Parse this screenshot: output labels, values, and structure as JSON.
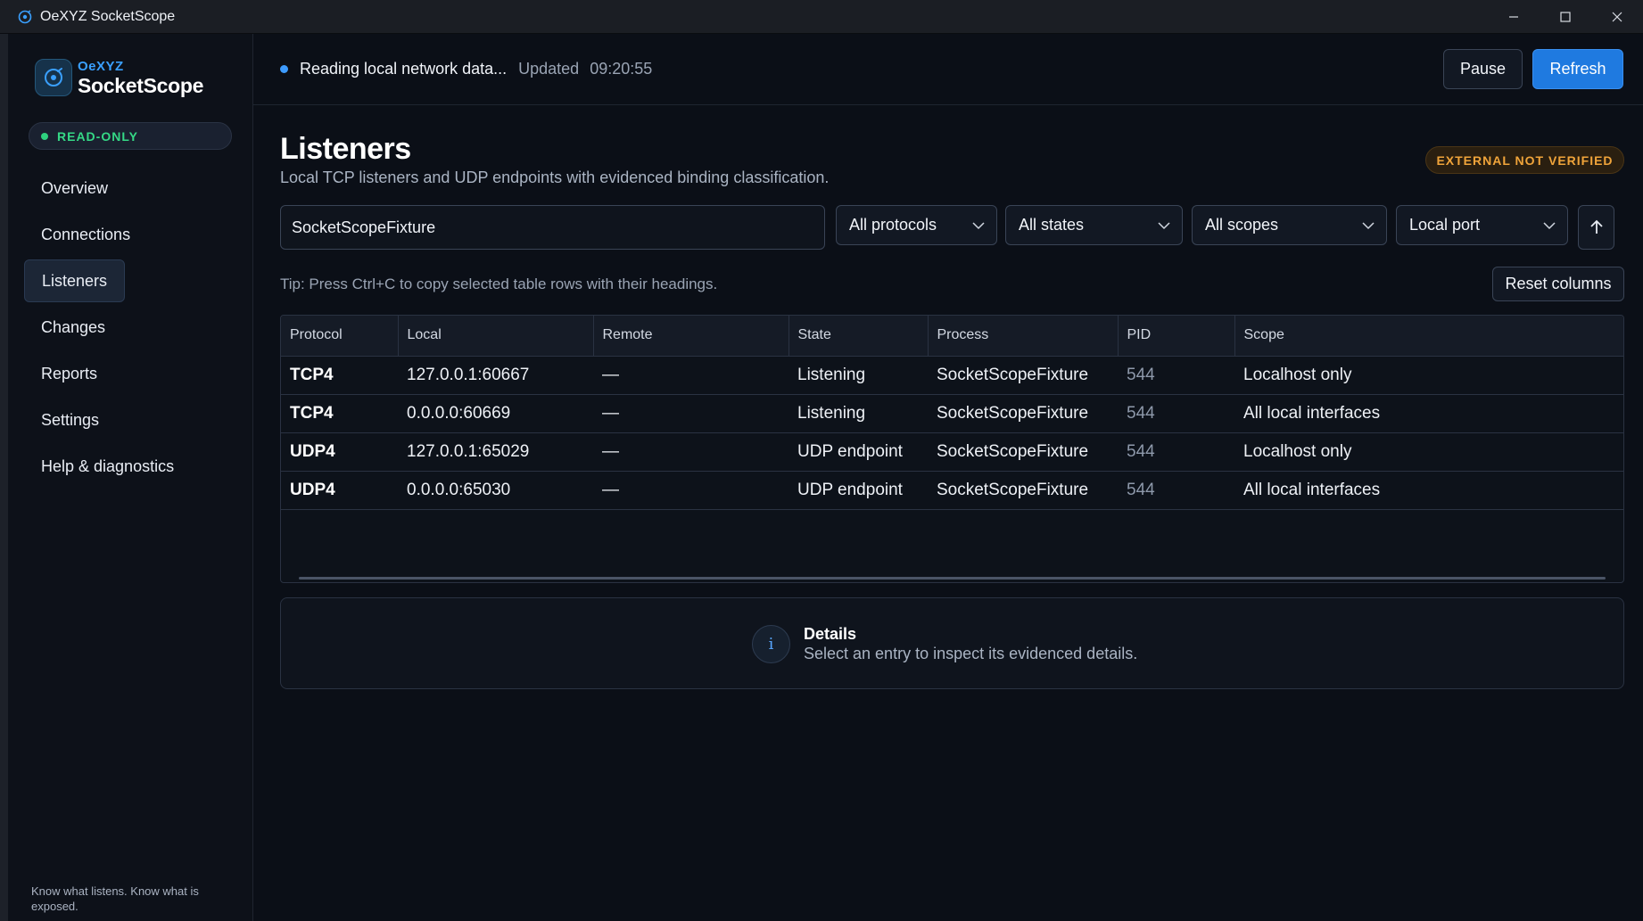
{
  "window": {
    "title": "OeXYZ SocketScope"
  },
  "brand": {
    "sub": "OeXYZ",
    "main": "SocketScope"
  },
  "mode_badge": "READ-ONLY",
  "nav": [
    {
      "label": "Overview",
      "active": false
    },
    {
      "label": "Connections",
      "active": false
    },
    {
      "label": "Listeners",
      "active": true
    },
    {
      "label": "Changes",
      "active": false
    },
    {
      "label": "Reports",
      "active": false
    },
    {
      "label": "Settings",
      "active": false
    },
    {
      "label": "Help & diagnostics",
      "active": false
    }
  ],
  "sidebar_footer": "Know what listens. Know what is exposed.",
  "status": {
    "text": "Reading local network data...",
    "updated_label": "Updated",
    "updated_time": "09:20:55"
  },
  "toolbar": {
    "pause_label": "Pause",
    "refresh_label": "Refresh"
  },
  "page": {
    "title": "Listeners",
    "subtitle": "Local TCP listeners and UDP endpoints with evidenced binding classification.",
    "badge": "EXTERNAL NOT VERIFIED"
  },
  "filters": {
    "search_value": "SocketScopeFixture",
    "protocol": "All protocols",
    "state": "All states",
    "scope": "All scopes",
    "sort": "Local port"
  },
  "tip": "Tip: Press Ctrl+C to copy selected table rows with their headings.",
  "reset_columns_label": "Reset columns",
  "table": {
    "columns": [
      "Protocol",
      "Local",
      "Remote",
      "State",
      "Process",
      "PID",
      "Scope"
    ],
    "rows": [
      [
        "TCP4",
        "127.0.0.1:60667",
        "—",
        "Listening",
        "SocketScopeFixture",
        "544",
        "Localhost only"
      ],
      [
        "TCP4",
        "0.0.0.0:60669",
        "—",
        "Listening",
        "SocketScopeFixture",
        "544",
        "All local interfaces"
      ],
      [
        "UDP4",
        "127.0.0.1:65029",
        "—",
        "UDP endpoint",
        "SocketScopeFixture",
        "544",
        "Localhost only"
      ],
      [
        "UDP4",
        "0.0.0.0:65030",
        "—",
        "UDP endpoint",
        "SocketScopeFixture",
        "544",
        "All local interfaces"
      ]
    ]
  },
  "details": {
    "icon": "i",
    "title": "Details",
    "text": "Select an entry to inspect its evidenced details."
  },
  "colors": {
    "accent": "#1f7ae0",
    "ok": "#35d986",
    "warn": "#f0a43a",
    "background": "#0b0f17"
  }
}
